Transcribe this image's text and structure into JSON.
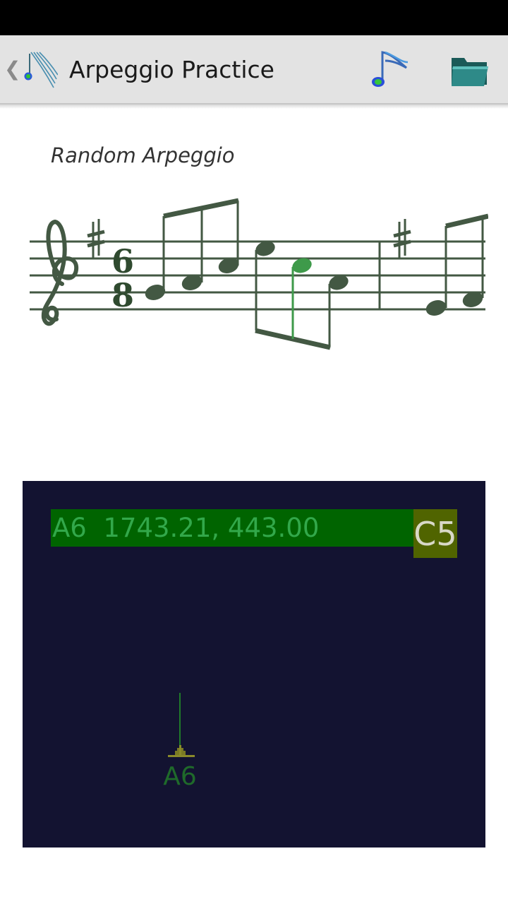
{
  "header": {
    "back_icon": "chevron-left-icon",
    "app_icon": "music-staff-icon",
    "title": "Arpeggio Practice",
    "actions": [
      {
        "name": "play-note-action",
        "icon": "music-note-icon"
      },
      {
        "name": "open-folder-action",
        "icon": "folder-icon"
      }
    ]
  },
  "exercise": {
    "label": "Random Arpeggio",
    "clef": "treble",
    "time_signature": {
      "top": "6",
      "bottom": "8"
    },
    "key_accidental": "sharp"
  },
  "tuner": {
    "readout": "A6  1743.21, 443.00",
    "target_note": "C5",
    "peak_note": "A6"
  },
  "colors": {
    "panel": "#131331",
    "readout_bg": "#006400",
    "readout_text": "#32a84a",
    "target_bg": "#506400",
    "staff_ink": "#435843",
    "current_note": "#3e9a4a"
  }
}
